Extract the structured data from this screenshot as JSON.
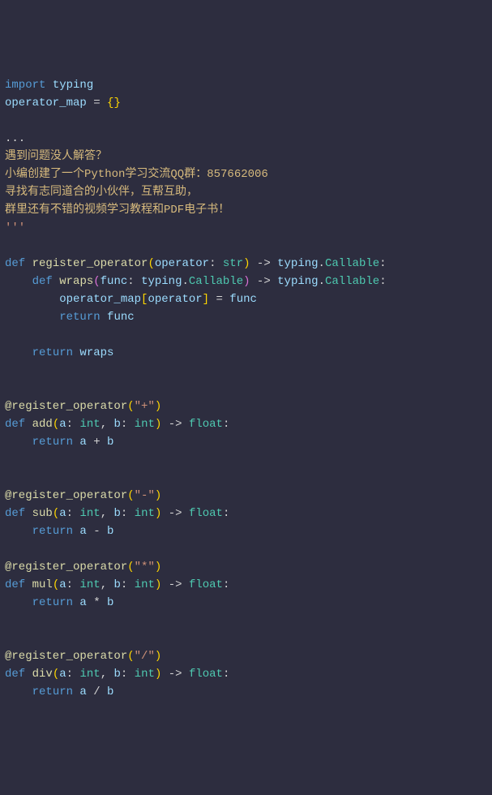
{
  "l1": {
    "import": "import",
    "typing": "typing"
  },
  "l2": {
    "name": "operator_map",
    "eq": " = ",
    "lb": "{",
    "rb": "}"
  },
  "l3": {
    "dots": "..."
  },
  "c1": "遇到问题没人解答？",
  "c2": "小编创建了一个Python学习交流QQ群：857662006",
  "c3": "寻找有志同道合的小伙伴，互帮互助，",
  "c4": "群里还有不错的视频学习教程和PDF电子书！",
  "l4": {
    "dots": "'''"
  },
  "ro": {
    "def": "def",
    "name": "register_operator",
    "lp": "(",
    "arg": "operator",
    "colon1": ": ",
    "argtype": "str",
    "rp": ")",
    "arrow": " -> ",
    "rt1": "typing",
    "dot": ".",
    "rt2": "Callable",
    "end": ":"
  },
  "wraps": {
    "def": "def",
    "name": "wraps",
    "lp": "(",
    "arg": "func",
    "colon1": ": ",
    "t1": "typing",
    "dot1": ".",
    "t2": "Callable",
    "rp": ")",
    "arrow": " -> ",
    "rt1": "typing",
    "dot2": ".",
    "rt2": "Callable",
    "end": ":"
  },
  "assign": {
    "map": "operator_map",
    "lb": "[",
    "key": "operator",
    "rb": "]",
    "eq": " = ",
    "val": "func"
  },
  "retfunc": {
    "ret": "return",
    "val": " func"
  },
  "retwraps": {
    "ret": "return",
    "val": " wraps"
  },
  "add": {
    "deco": "@register_operator",
    "lp": "(",
    "s": "\"+\"",
    "rp": ")",
    "def": "def",
    "name": "add",
    "lp2": "(",
    "a": "a",
    "c1": ": ",
    "int1": "int",
    "comma": ", ",
    "b": "b",
    "c2": ": ",
    "int2": "int",
    "rp2": ")",
    "arrow": " -> ",
    "ret": "float",
    "end": ":",
    "rkw": "return",
    "ea": " a ",
    "op": "+",
    "eb": " b"
  },
  "sub": {
    "deco": "@register_operator",
    "lp": "(",
    "s": "\"-\"",
    "rp": ")",
    "def": "def",
    "name": "sub",
    "lp2": "(",
    "a": "a",
    "c1": ": ",
    "int1": "int",
    "comma": ", ",
    "b": "b",
    "c2": ": ",
    "int2": "int",
    "rp2": ")",
    "arrow": " -> ",
    "ret": "float",
    "end": ":",
    "rkw": "return",
    "ea": " a ",
    "op": "-",
    "eb": " b"
  },
  "mul": {
    "deco": "@register_operator",
    "lp": "(",
    "s": "\"*\"",
    "rp": ")",
    "def": "def",
    "name": "mul",
    "lp2": "(",
    "a": "a",
    "c1": ": ",
    "int1": "int",
    "comma": ", ",
    "b": "b",
    "c2": ": ",
    "int2": "int",
    "rp2": ")",
    "arrow": " -> ",
    "ret": "float",
    "end": ":",
    "rkw": "return",
    "ea": " a ",
    "op": "*",
    "eb": " b"
  },
  "div": {
    "deco": "@register_operator",
    "lp": "(",
    "s": "\"/\"",
    "rp": ")",
    "def": "def",
    "name": "div",
    "lp2": "(",
    "a": "a",
    "c1": ": ",
    "int1": "int",
    "comma": ", ",
    "b": "b",
    "c2": ": ",
    "int2": "int",
    "rp2": ")",
    "arrow": " -> ",
    "ret": "float",
    "end": ":",
    "rkw": "return",
    "ea": " a ",
    "op": "/",
    "eb": " b"
  }
}
